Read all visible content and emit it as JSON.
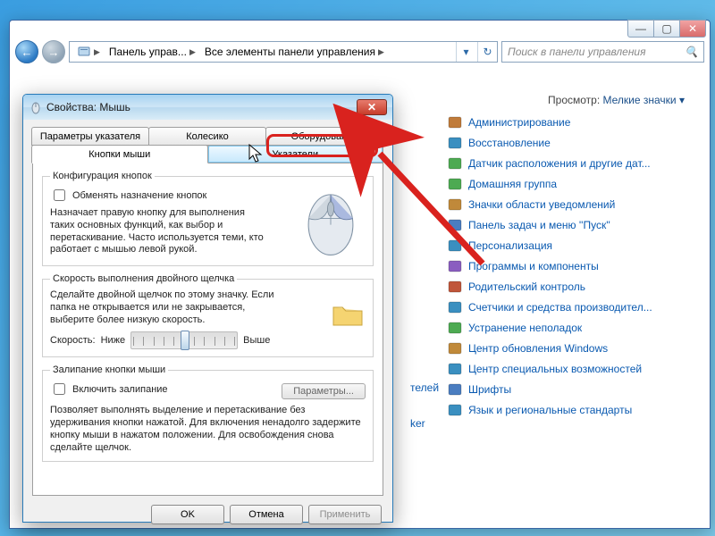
{
  "explorer": {
    "breadcrumb": {
      "seg1": "Панель управ...",
      "seg2": "Все элементы панели управления"
    },
    "search_placeholder": "Поиск в панели управления",
    "view_label": "Просмотр:",
    "view_value": "Мелкие значки",
    "items": [
      "Администрирование",
      "Восстановление",
      "Датчик расположения и другие дат...",
      "Домашняя группа",
      "Значки области уведомлений",
      "Панель задач и меню ''Пуск''",
      "Персонализация",
      "Программы и компоненты",
      "Родительский контроль",
      "Счетчики и средства производител...",
      "Устранение неполадок",
      "Центр обновления Windows",
      "Центр специальных возможностей",
      "Шрифты",
      "Язык и региональные стандарты"
    ],
    "partial_items": {
      "a": "телей",
      "b": "ker"
    }
  },
  "dialog": {
    "title": "Свойства: Мышь",
    "tabs": {
      "row1": [
        "Параметры указателя",
        "Колесико",
        "Оборудование"
      ],
      "row2": [
        "Кнопки мыши",
        "Указатели"
      ]
    },
    "group1": {
      "legend": "Конфигурация кнопок",
      "checkbox": "Обменять назначение кнопок",
      "desc": "Назначает правую кнопку для выполнения таких основных функций, как выбор и перетаскивание. Часто используется теми, кто работает с мышью левой рукой."
    },
    "group2": {
      "legend": "Скорость выполнения двойного щелчка",
      "desc": "Сделайте двойной щелчок по этому значку. Если папка не открывается или не закрывается, выберите более низкую скорость.",
      "speed_label": "Скорость:",
      "slow": "Ниже",
      "fast": "Выше"
    },
    "group3": {
      "legend": "Залипание кнопки мыши",
      "checkbox": "Включить залипание",
      "params_btn": "Параметры...",
      "desc": "Позволяет выполнять выделение и перетаскивание без удерживания кнопки нажатой. Для включения ненадолго задержите кнопку мыши в нажатом положении. Для освобождения снова сделайте щелчок."
    },
    "buttons": {
      "ok": "OK",
      "cancel": "Отмена",
      "apply": "Применить"
    }
  }
}
